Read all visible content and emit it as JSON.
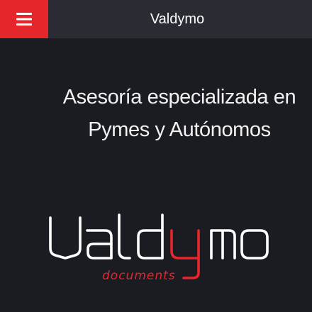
{
  "header": {
    "title": "Valdymo",
    "menu_icon": "hamburger-menu-icon"
  },
  "hero": {
    "tagline_line1": "Asesoría especializada en",
    "tagline_line2": "Pymes y Autónomos"
  },
  "logo": {
    "name": "Valdymo",
    "subtitle": "documents",
    "accent_color": "#e5262b"
  },
  "colors": {
    "background": "#1b1c22",
    "header": "#2a2b33",
    "accent": "#e5262b"
  }
}
